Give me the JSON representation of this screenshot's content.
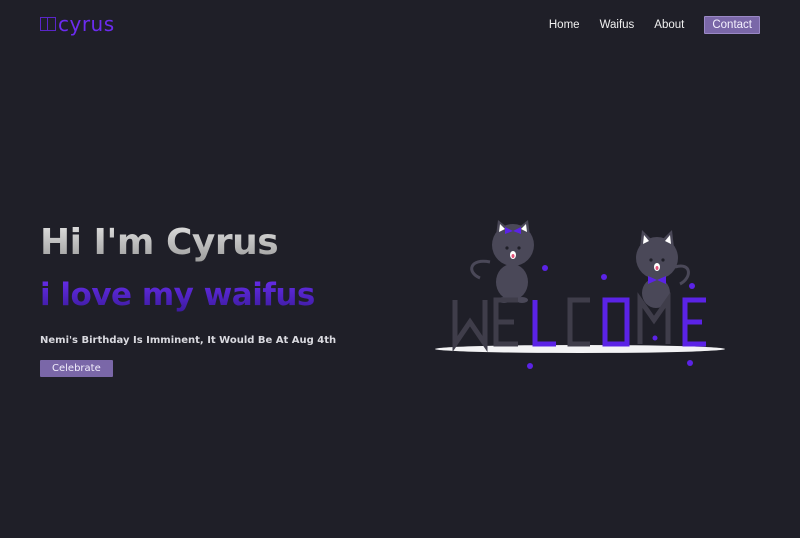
{
  "brand": {
    "name": "cyrus",
    "color": "#6c2bf0"
  },
  "nav": {
    "items": [
      {
        "label": "Home"
      },
      {
        "label": "Waifus"
      },
      {
        "label": "About"
      }
    ],
    "contact_label": "Contact"
  },
  "hero": {
    "title": "Hi I'm Cyrus",
    "subtitle": "i love my waifus",
    "note": "Nemi's Birthday Is Imminent, It Would Be At Aug 4th",
    "button_label": "Celebrate"
  },
  "illustration": {
    "letters": [
      "W",
      "E",
      "L",
      "C",
      "O",
      "M",
      "E"
    ],
    "accent_color": "#5b23e6",
    "base_color": "#3f3d4a"
  },
  "colors": {
    "background": "#1f1f28",
    "button": "#7a67a8"
  }
}
